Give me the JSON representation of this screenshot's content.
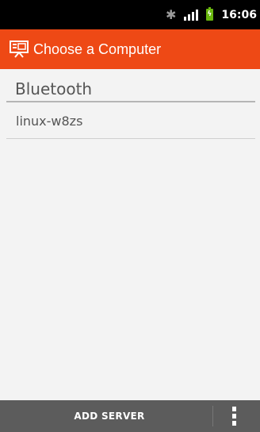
{
  "status_bar": {
    "time": "16:06",
    "icons": [
      "bluetooth-icon",
      "signal-icon",
      "battery-charging-icon"
    ]
  },
  "action_bar": {
    "title": "Choose a Computer",
    "icon": "presentation-screen-icon"
  },
  "list": {
    "section_header": "Bluetooth",
    "items": [
      {
        "label": "linux-w8zs"
      }
    ]
  },
  "bottom_bar": {
    "add_server_label": "ADD SERVER",
    "overflow_icon": "overflow-menu-icon"
  },
  "colors": {
    "action_bar": "#ee4915",
    "background": "#f3f3f3",
    "bottom_bar": "#5c5c5c",
    "battery": "#6ab70f"
  }
}
